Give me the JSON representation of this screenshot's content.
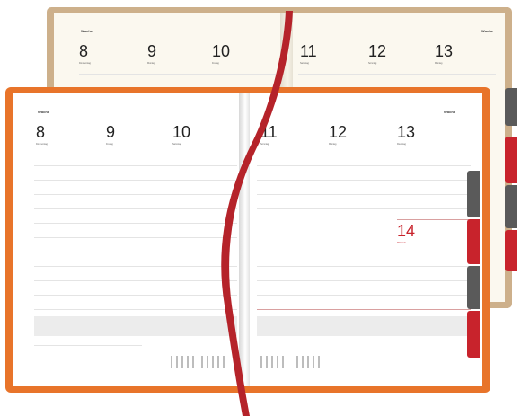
{
  "back_planner": {
    "left_page": {
      "header": "Woche",
      "days": [
        {
          "number": "8",
          "name": "Donnerstag"
        },
        {
          "number": "9",
          "name": "Montag"
        },
        {
          "number": "10",
          "name": "Freitag"
        }
      ]
    },
    "right_page": {
      "header": "Woche",
      "days": [
        {
          "number": "11",
          "name": "Samstag"
        },
        {
          "number": "12",
          "name": "Sonntag"
        },
        {
          "number": "13",
          "name": "Montag"
        }
      ]
    }
  },
  "front_planner": {
    "left_page": {
      "header": "Woche",
      "days": [
        {
          "number": "8",
          "name": "Donnerstag"
        },
        {
          "number": "9",
          "name": "Freitag"
        },
        {
          "number": "10",
          "name": "Samstag"
        }
      ]
    },
    "right_page": {
      "header": "Woche",
      "days": [
        {
          "number": "11",
          "name": "Sonntag"
        },
        {
          "number": "12",
          "name": "Montag"
        },
        {
          "number": "13",
          "name": "Dienstag"
        }
      ],
      "highlight_day": {
        "number": "14",
        "name": "Mittwoch"
      }
    }
  },
  "colors": {
    "cover_orange": "#e8742a",
    "cover_tan": "#cdb08b",
    "ribbon_red": "#b5232a",
    "tab_red": "#c8232c",
    "tab_grey": "#5a5a5a",
    "accent_red": "#c8232c"
  }
}
